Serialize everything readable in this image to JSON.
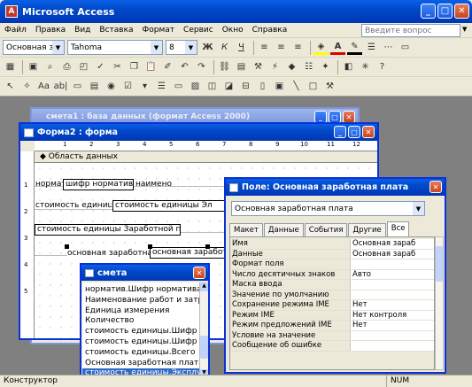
{
  "app": {
    "title": "Microsoft Access"
  },
  "menu": [
    "Файл",
    "Правка",
    "Вид",
    "Вставка",
    "Формат",
    "Сервис",
    "Окно",
    "Справка"
  ],
  "help_search": {
    "placeholder": "Введите вопрос"
  },
  "format_bar": {
    "object": "Основная зара",
    "font": "Tahoma",
    "size": "8"
  },
  "db_window": {
    "title": "смета1 : база данных (формат Access 2000)"
  },
  "form_window": {
    "title": "Форма2 : форма",
    "ruler": [
      "1",
      "2",
      "3",
      "4",
      "5",
      "6",
      "7",
      "8",
      "9",
      "10",
      "11",
      "12"
    ],
    "section": "Область данных",
    "vruler": [
      "1",
      "2",
      "3",
      "4",
      "5"
    ],
    "controls": [
      {
        "kind": "label",
        "text": "нормативн"
      },
      {
        "kind": "text",
        "text": "шифр нормативн"
      },
      {
        "kind": "label",
        "text": "наимено"
      },
      {
        "kind": "label",
        "text": "стоимость единицы измерения"
      },
      {
        "kind": "text",
        "text": "стоимость единицы Эл"
      },
      {
        "kind": "text",
        "text": "стоимость единицы Заработной пл"
      },
      {
        "kind": "label",
        "text": "основная заработная плата"
      },
      {
        "kind": "text",
        "text": "основная заработная плата"
      }
    ]
  },
  "properties": {
    "title": "Поле: Основная заработная плата",
    "object": "Основная заработная плата",
    "tabs": [
      "Макет",
      "Данные",
      "События",
      "Другие",
      "Все"
    ],
    "active_tab": "Все",
    "rows": [
      {
        "k": "Имя",
        "v": "Основная зараб"
      },
      {
        "k": "Данные",
        "v": "Основная зараб"
      },
      {
        "k": "Формат поля",
        "v": ""
      },
      {
        "k": "Число десятичных знаков",
        "v": "Авто"
      },
      {
        "k": "Маска ввода",
        "v": ""
      },
      {
        "k": "Значение по умолчанию",
        "v": ""
      },
      {
        "k": "Сохранение режима IME",
        "v": "Нет"
      },
      {
        "k": "Режим IME",
        "v": "Нет контроля"
      },
      {
        "k": "Режим предложений IME",
        "v": "Нет"
      },
      {
        "k": "Условие на значение",
        "v": ""
      },
      {
        "k": "Сообщение об ошибке",
        "v": ""
      }
    ]
  },
  "field_list": {
    "title": "смета",
    "items": [
      "норматив.Шифр норматива",
      "Наименование работ и затрат",
      "Единица измерения",
      "Количество",
      "стоимость единицы.Шифр норм",
      "стоимость единицы.Шифр стои",
      "стоимость единицы.Всего",
      "Основная заработная плата",
      "стоимость единицы.Эксплуатац"
    ],
    "selected_index": 8
  },
  "statusbar": {
    "mode": "Конструктор",
    "num": "NUM"
  },
  "colors": {
    "titlebar": "#0055E5",
    "workspace": "#808080",
    "selection": "#316AC5"
  }
}
